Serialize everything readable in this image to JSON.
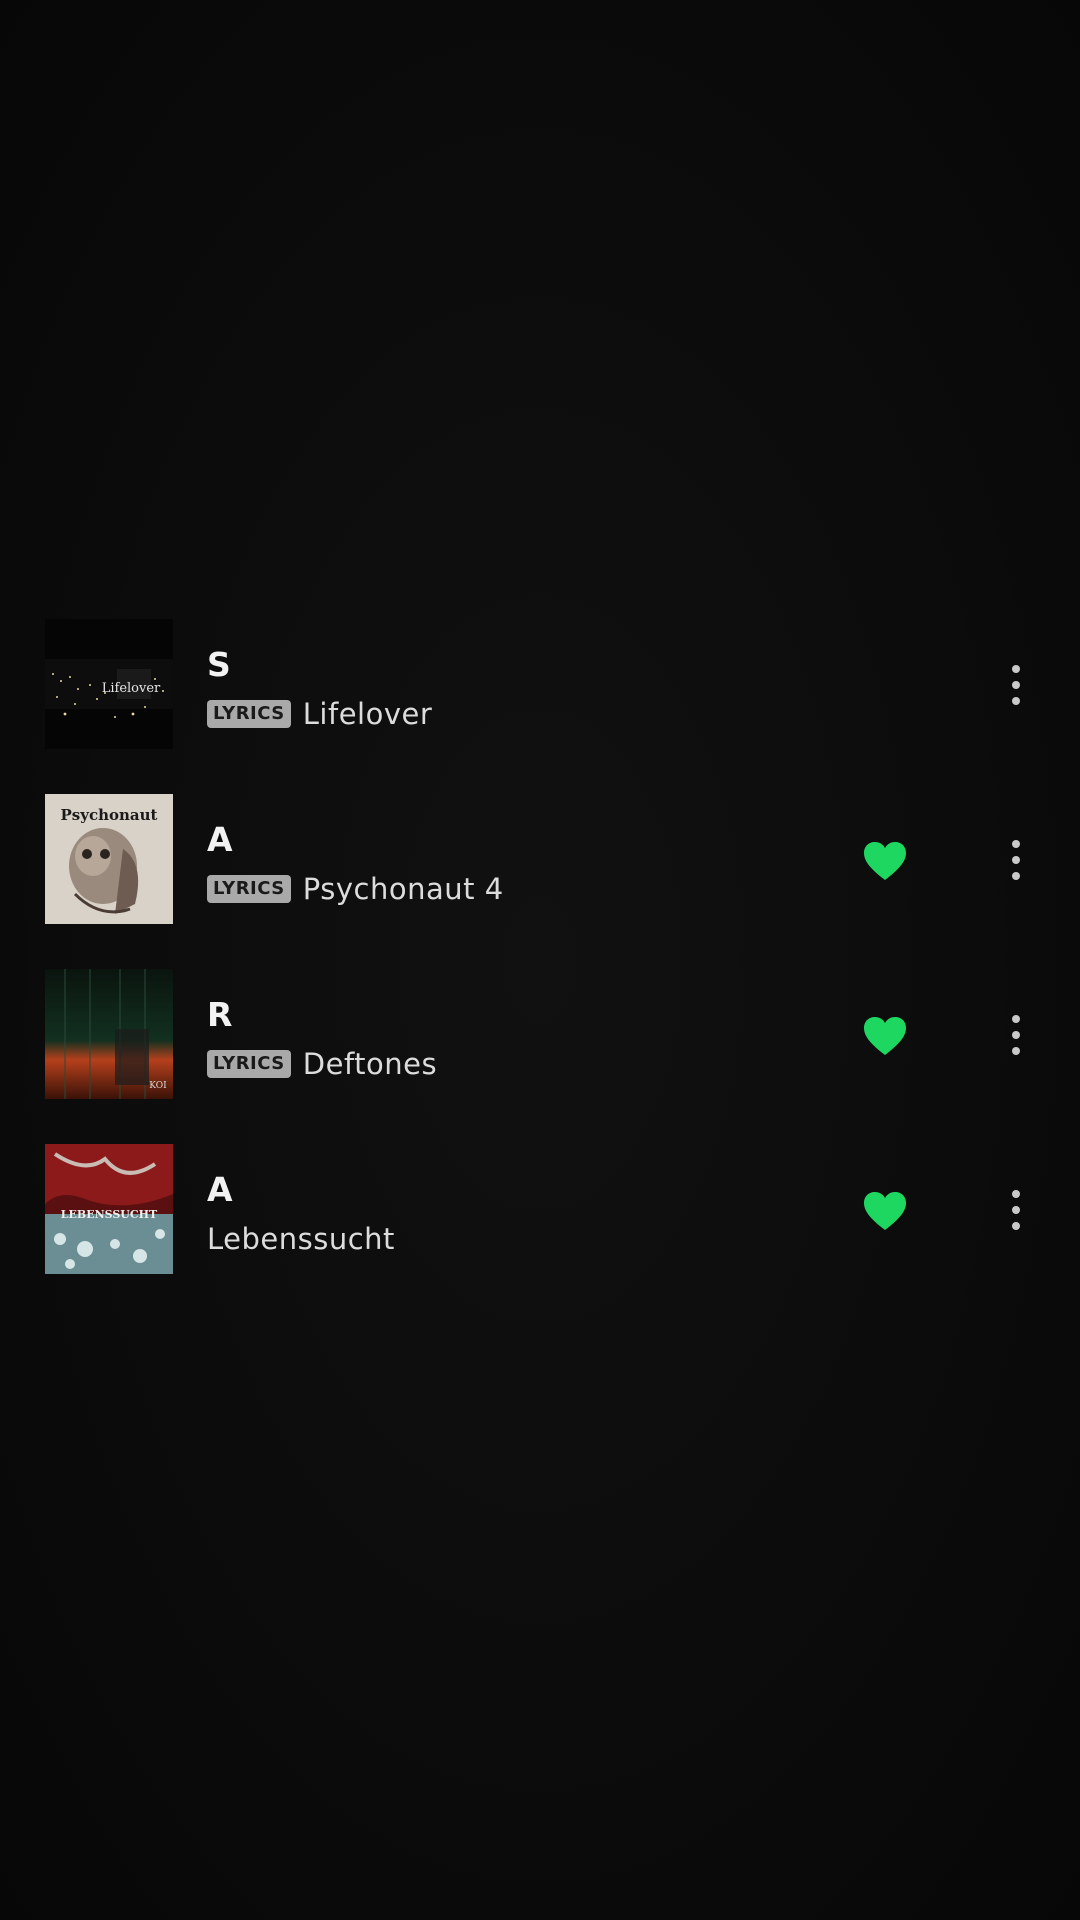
{
  "colors": {
    "background": "#0b0b0b",
    "accent_heart": "#1ed760",
    "badge_bg": "#a9a9a9",
    "text_primary": "#f2f2f2",
    "text_secondary": "#dcdcdc"
  },
  "tracks": [
    {
      "title": "S",
      "badge": "LYRICS",
      "artist": "Lifelover",
      "liked": false,
      "art_text": "Lifelover"
    },
    {
      "title": "A",
      "badge": "LYRICS",
      "artist": "Psychonaut 4",
      "liked": true,
      "art_text": "Psychonaut"
    },
    {
      "title": "R",
      "badge": "LYRICS",
      "artist": "Deftones",
      "liked": true,
      "art_text": "KOI"
    },
    {
      "title": "A",
      "badge": "",
      "artist": "Lebenssucht",
      "liked": true,
      "art_text": "LEBENSSUCHT"
    }
  ],
  "icons": {
    "heart": "heart-filled-icon",
    "more": "more-vertical-icon"
  }
}
